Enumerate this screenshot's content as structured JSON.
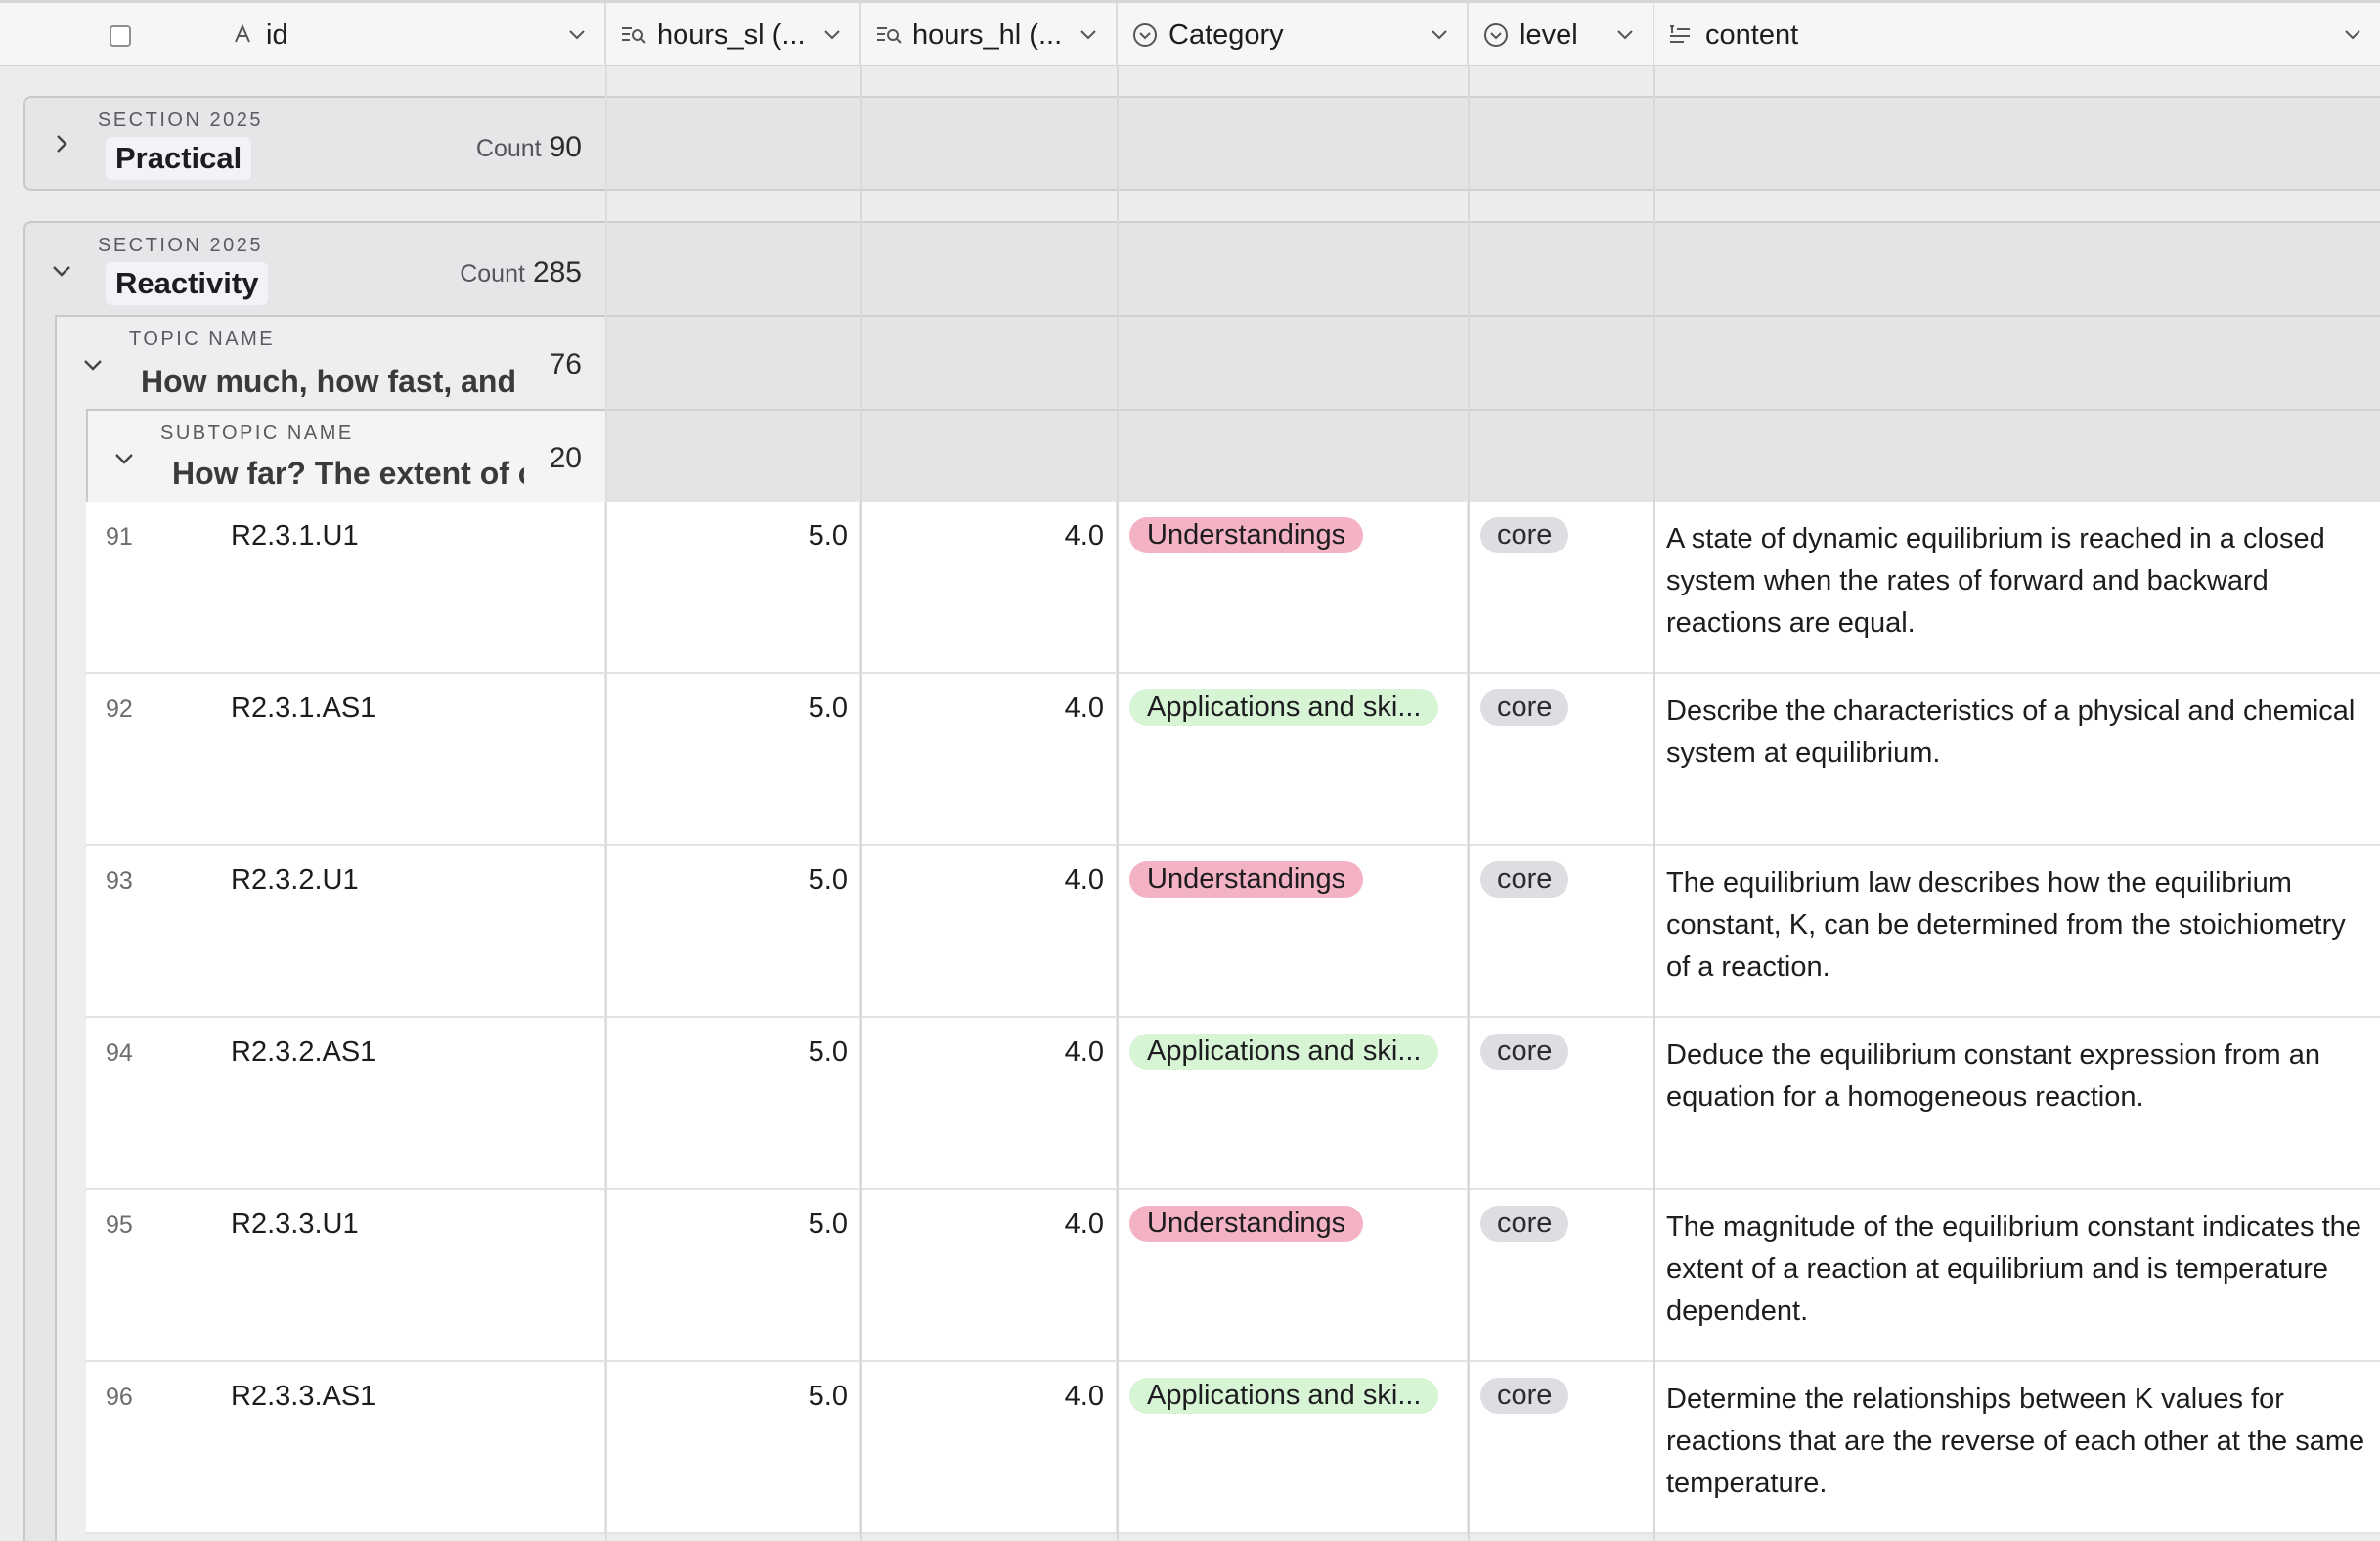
{
  "header": {
    "columns": [
      {
        "key": "id",
        "label": "id",
        "icon": "text-type-icon"
      },
      {
        "key": "hours_sl",
        "label": "hours_sl (...",
        "icon": "lookup-icon"
      },
      {
        "key": "hours_hl",
        "label": "hours_hl (...",
        "icon": "lookup-icon"
      },
      {
        "key": "category",
        "label": "Category",
        "icon": "select-icon"
      },
      {
        "key": "level",
        "label": "level",
        "icon": "select-icon"
      },
      {
        "key": "content",
        "label": "content",
        "icon": "long-text-icon"
      }
    ]
  },
  "groups": {
    "practical": {
      "section_label": "SECTION 2025",
      "name": "Practical",
      "count_label": "Count",
      "count": "90"
    },
    "reactivity": {
      "section_label": "SECTION 2025",
      "name": "Reactivity",
      "count_label": "Count",
      "count": "285"
    },
    "topic": {
      "label": "TOPIC NAME",
      "name": "How much, how fast, and how far?",
      "count": "76"
    },
    "subtopic": {
      "label": "SUBTOPIC NAME",
      "name": "How far? The extent of chemical change",
      "count": "20"
    }
  },
  "rows": [
    {
      "n": "91",
      "id": "R2.3.1.U1",
      "hours_sl": "5.0",
      "hours_hl": "4.0",
      "category": "Understandings",
      "category_type": "u",
      "level": "core",
      "content": "A state of dynamic equilibrium is reached in a closed system when the rates of forward and backward reactions are equal."
    },
    {
      "n": "92",
      "id": "R2.3.1.AS1",
      "hours_sl": "5.0",
      "hours_hl": "4.0",
      "category": "Applications and ski...",
      "category_type": "a",
      "level": "core",
      "content": "Describe the characteristics of a physical and chemical system at equilibrium."
    },
    {
      "n": "93",
      "id": "R2.3.2.U1",
      "hours_sl": "5.0",
      "hours_hl": "4.0",
      "category": "Understandings",
      "category_type": "u",
      "level": "core",
      "content": "The equilibrium law describes how the equilibrium constant, K, can be determined from the stoichiometry of a reaction."
    },
    {
      "n": "94",
      "id": "R2.3.2.AS1",
      "hours_sl": "5.0",
      "hours_hl": "4.0",
      "category": "Applications and ski...",
      "category_type": "a",
      "level": "core",
      "content": "Deduce the equilibrium constant expression from an equation for a homogeneous reaction."
    },
    {
      "n": "95",
      "id": "R2.3.3.U1",
      "hours_sl": "5.0",
      "hours_hl": "4.0",
      "category": "Understandings",
      "category_type": "u",
      "level": "core",
      "content": "The magnitude of the equilibrium constant indicates the extent of a reaction at equilibrium and is temperature dependent."
    },
    {
      "n": "96",
      "id": "R2.3.3.AS1",
      "hours_sl": "5.0",
      "hours_hl": "4.0",
      "category": "Applications and ski...",
      "category_type": "a",
      "level": "core",
      "content": "Determine the relationships between K values for reactions that are the reverse of each other at the same temperature."
    }
  ]
}
